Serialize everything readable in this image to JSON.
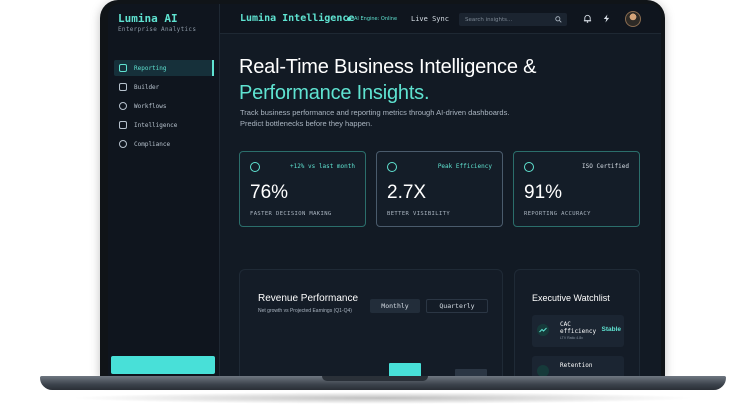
{
  "sidebar": {
    "brand_title": "Lumina AI",
    "brand_subtitle": "Enterprise Analytics",
    "items": [
      {
        "label": "Reporting",
        "icon": "grid-icon",
        "active": true
      },
      {
        "label": "Builder",
        "icon": "list-icon",
        "active": false
      },
      {
        "label": "Workflows",
        "icon": "workflow-icon",
        "active": false
      },
      {
        "label": "Intelligence",
        "icon": "document-icon",
        "active": false
      },
      {
        "label": "Compliance",
        "icon": "shield-icon",
        "active": false
      }
    ]
  },
  "topbar": {
    "title": "Lumina Intelligence",
    "engine_status": "AI Engine: Online",
    "live_sync": "Live Sync",
    "search_placeholder": "Search insights...",
    "icons": [
      "search-icon",
      "bell-icon",
      "lightning-icon",
      "avatar"
    ]
  },
  "hero": {
    "title_line1": "Real-Time Business Intelligence &",
    "title_line2": "Performance Insights.",
    "subtitle": "Track business performance and reporting metrics through AI-driven dashboards. Predict bottlenecks before they happen."
  },
  "stats": [
    {
      "tag": "+12% vs last month",
      "value": "76%",
      "label": "FASTER DECISION MAKING",
      "icon": "gauge-icon"
    },
    {
      "tag": "Peak Efficiency",
      "value": "2.7X",
      "label": "BETTER VISIBILITY",
      "icon": "eye-icon"
    },
    {
      "tag": "ISO Certified",
      "value": "91%",
      "label": "REPORTING ACCURACY",
      "icon": "check-icon"
    }
  ],
  "revenue": {
    "title": "Revenue Performance",
    "subtitle": "Net growth vs Projected Earnings (Q1-Q4)",
    "tabs": [
      "Monthly",
      "Quarterly"
    ]
  },
  "watchlist": {
    "title": "Executive Watchlist",
    "items": [
      {
        "name": "CAC efficiency",
        "meta": "LTV Ratio 4.8x",
        "status": "Stable"
      },
      {
        "name": "Retention",
        "meta": "",
        "status": ""
      }
    ]
  },
  "colors": {
    "accent": "#5fe3d1",
    "background": "#121a24",
    "panel": "#141c27"
  }
}
